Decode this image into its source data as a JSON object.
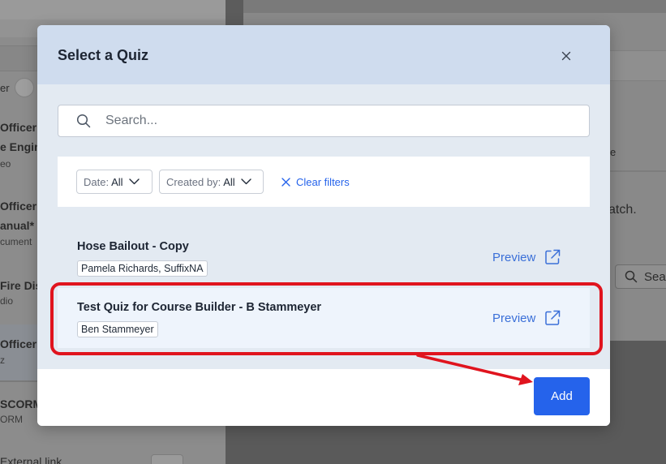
{
  "background": {
    "left_items": [
      {
        "line1": "er",
        "line2": ""
      },
      {
        "line1": "Officer",
        "line2": "e Engin",
        "line3": "eo"
      },
      {
        "line1": "Officer",
        "line2": "anual*",
        "line3": "cument"
      },
      {
        "line1": "Fire Dis",
        "line2": "dio"
      },
      {
        "line1": "Officer",
        "line2": "z"
      },
      {
        "line1": "SCORM",
        "line2": "ORM"
      },
      {
        "line1": "External link"
      }
    ],
    "right_text": {
      "e_label": "e",
      "atch_label": "atch.",
      "search_placeholder": "Sea"
    }
  },
  "modal": {
    "title": "Select a Quiz",
    "search": {
      "placeholder": "Search...",
      "value": ""
    },
    "filters": {
      "date_label": "Date:",
      "date_value": "All",
      "created_label": "Created by:",
      "created_value": "All",
      "clear_label": "Clear filters"
    },
    "quizzes": [
      {
        "title": "Hose Bailout - Copy",
        "tag": "Pamela Richards, SuffixNA",
        "preview_label": "Preview"
      },
      {
        "title": "Test Quiz for Course Builder - B Stammeyer",
        "tag": "Ben Stammeyer",
        "preview_label": "Preview",
        "selected": true
      }
    ],
    "add_label": "Add"
  },
  "colors": {
    "accent": "#2563eb",
    "annotation": "#e0141e",
    "header_bg": "#cfdcee",
    "selected_row_bg": "#eef4fc"
  }
}
